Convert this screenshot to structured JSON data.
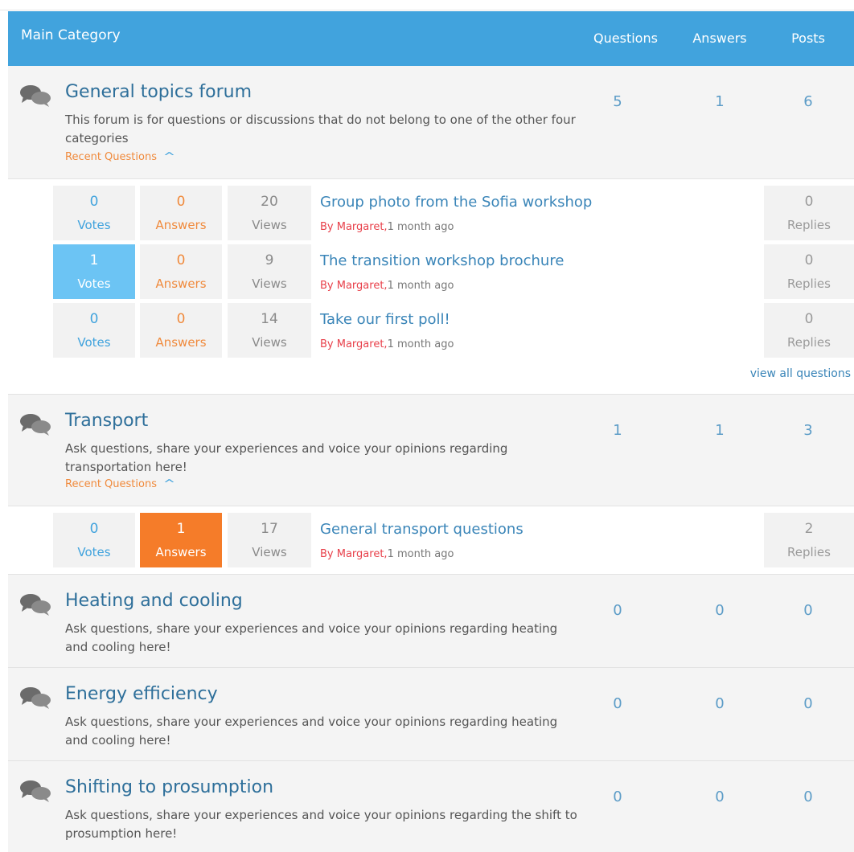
{
  "header": {
    "main": "Main Category",
    "questions": "Questions",
    "answers": "Answers",
    "posts": "Posts"
  },
  "categories": [
    {
      "title": "General topics forum",
      "desc": "This forum is for questions or discussions that do not belong to one of the other four categories",
      "recent": "Recent Questions",
      "questions": "5",
      "answers": "1",
      "posts": "6",
      "items": [
        {
          "votes": "0",
          "votes_label": "Votes",
          "answers": "0",
          "answers_label": "Answers",
          "views": "20",
          "views_label": "Views",
          "title": "Group photo from the Sofia workshop",
          "author": "By Margaret,",
          "time": "1 month  ago",
          "replies": "0",
          "replies_label": "Replies"
        },
        {
          "votes": "1",
          "votes_label": "Votes",
          "answers": "0",
          "answers_label": "Answers",
          "views": "9",
          "views_label": "Views",
          "title": "The transition workshop brochure",
          "author": "By Margaret,",
          "time": "1 month  ago",
          "replies": "0",
          "replies_label": "Replies"
        },
        {
          "votes": "0",
          "votes_label": "Votes",
          "answers": "0",
          "answers_label": "Answers",
          "views": "14",
          "views_label": "Views",
          "title": "Take our first poll!",
          "author": "By Margaret,",
          "time": "1 month  ago",
          "replies": "0",
          "replies_label": "Replies"
        }
      ],
      "view_all": "view all questions"
    },
    {
      "title": "Transport",
      "desc": "Ask questions, share your experiences and voice your opinions regarding transportation here!",
      "recent": "Recent Questions",
      "questions": "1",
      "answers": "1",
      "posts": "3",
      "items": [
        {
          "votes": "0",
          "votes_label": "Votes",
          "answers": "1",
          "answers_label": "Answers",
          "views": "17",
          "views_label": "Views",
          "title": "General transport questions",
          "author": "By Margaret,",
          "time": "1 month  ago",
          "replies": "2",
          "replies_label": "Replies"
        }
      ]
    },
    {
      "title": "Heating and cooling",
      "desc": "Ask questions, share your experiences and voice your opinions regarding heating and cooling here!",
      "questions": "0",
      "answers": "0",
      "posts": "0"
    },
    {
      "title": "Energy efficiency",
      "desc": "Ask questions, share your experiences and voice your opinions regarding heating and cooling here!",
      "questions": "0",
      "answers": "0",
      "posts": "0"
    },
    {
      "title": "Shifting to prosumption",
      "desc": "Ask questions, share your experiences and voice your opinions regarding the shift to prosumption here!",
      "questions": "0",
      "answers": "0",
      "posts": "0"
    }
  ],
  "icons": {
    "chat": "chat-bubbles-icon",
    "chevron": "chevron-up-icon"
  },
  "colors": {
    "header": "#41a3dd",
    "accent_orange": "#f57c29",
    "accent_blue": "#6cc4f4",
    "author_red": "#e8404a"
  }
}
